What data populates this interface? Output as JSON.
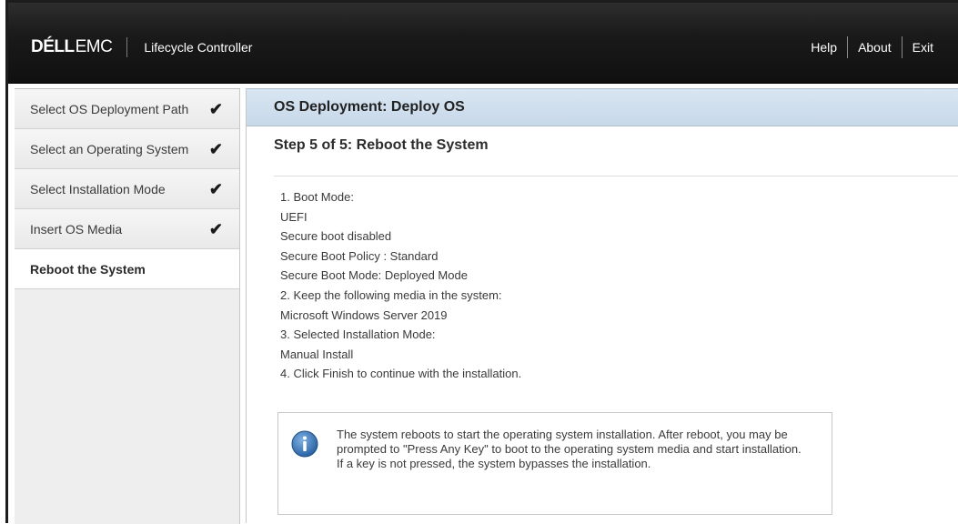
{
  "header": {
    "logo_dell": "DÉLL",
    "logo_emc": "EMC",
    "product": "Lifecycle Controller",
    "nav": {
      "help": "Help",
      "about": "About",
      "exit": "Exit"
    }
  },
  "sidebar": {
    "items": [
      {
        "label": "Select OS Deployment Path",
        "checked": "✔"
      },
      {
        "label": "Select an Operating System",
        "checked": "✔"
      },
      {
        "label": "Select Installation Mode",
        "checked": "✔"
      },
      {
        "label": "Insert OS Media",
        "checked": "✔"
      },
      {
        "label": "Reboot the System"
      }
    ]
  },
  "main": {
    "page_title": "OS Deployment: Deploy OS",
    "step_title": "Step 5 of 5: Reboot the System",
    "lines": [
      "1. Boot Mode:",
      "UEFI",
      "Secure boot disabled",
      "Secure Boot Policy : Standard",
      "Secure Boot Mode: Deployed Mode",
      "2. Keep the following media in the system:",
      "Microsoft Windows Server 2019",
      "3. Selected Installation Mode:",
      "Manual Install",
      "4. Click Finish to continue with the installation."
    ],
    "note": "The system reboots to start the operating system installation. After reboot, you may be prompted to \"Press Any Key\" to boot to the operating system media and start installation. If a key is not pressed, the system bypasses the installation."
  },
  "colors": {
    "header_bg": "#1a1a1a",
    "title_bar": "#c7d8e9",
    "sidebar_bg": "#eeeeee",
    "info_icon": "#2f6fb0"
  },
  "icons": {
    "check": "checkmark-icon",
    "info": "info-icon"
  }
}
